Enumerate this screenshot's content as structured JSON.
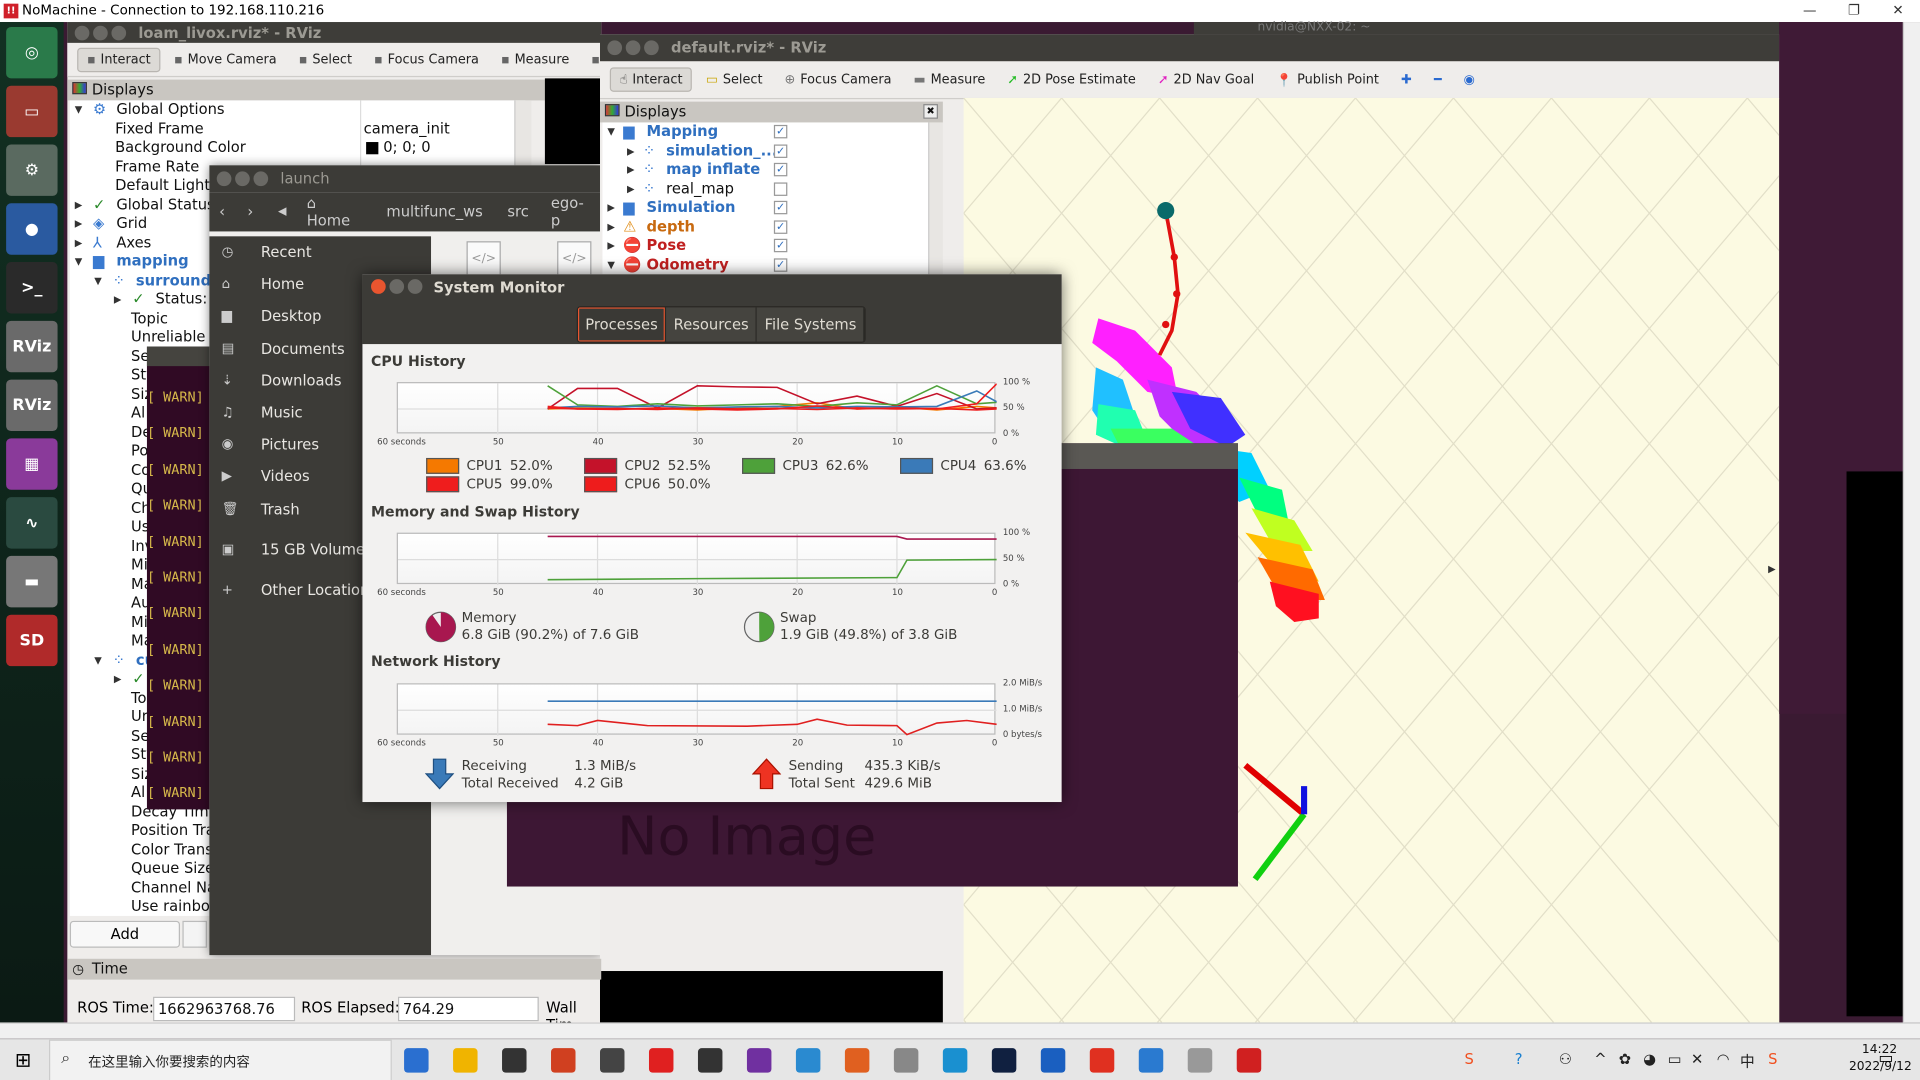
{
  "nomachine": {
    "title": "NoMachine - Connection to 192.168.110.216",
    "logo": "nm",
    "controls": [
      "—",
      "❐",
      "✕"
    ]
  },
  "dock": {
    "items": [
      {
        "name": "ubuntu-logo",
        "color": "#2a7a4a",
        "glyph": "◎"
      },
      {
        "name": "files",
        "color": "#9a3a30",
        "glyph": "▭"
      },
      {
        "name": "settings",
        "color": "#5a6a60",
        "glyph": "⚙"
      },
      {
        "name": "chromium",
        "color": "#2a5aa0",
        "glyph": "●"
      },
      {
        "name": "terminal",
        "color": "#2a2a2a",
        "glyph": ">_"
      },
      {
        "name": "rviz-1",
        "color": "#6a6a6a",
        "glyph": "RViz"
      },
      {
        "name": "rviz-2",
        "color": "#6a6a6a",
        "glyph": "RViz"
      },
      {
        "name": "workspace",
        "color": "#8a3a9a",
        "glyph": "▦"
      },
      {
        "name": "system-monitor",
        "color": "#2a4a40",
        "glyph": "∿"
      },
      {
        "name": "drive",
        "color": "#777",
        "glyph": "▬"
      },
      {
        "name": "sd-card",
        "color": "#b02a2a",
        "glyph": "SD"
      }
    ]
  },
  "left_rviz": {
    "title": "loam_livox.rviz* - RViz",
    "toolbar": [
      "Interact",
      "Move Camera",
      "Select",
      "Focus Camera",
      "Measure",
      "2"
    ],
    "displays_title": "Displays",
    "tree": [
      {
        "t": "Global Options",
        "v": "",
        "lvl": 0,
        "ar": "▼",
        "ic": "⚙",
        "cls": ""
      },
      {
        "t": "Fixed Frame",
        "v": "camera_init",
        "lvl": 1,
        "ar": "",
        "ic": "",
        "cls": ""
      },
      {
        "t": "Background Color",
        "v": "0; 0; 0",
        "lvl": 1,
        "ar": "",
        "ic": "",
        "cls": ""
      },
      {
        "t": "Frame Rate",
        "v": "",
        "lvl": 1,
        "ar": "",
        "ic": "",
        "cls": ""
      },
      {
        "t": "Default Light",
        "v": "",
        "lvl": 1,
        "ar": "",
        "ic": "",
        "cls": ""
      },
      {
        "t": "Global Status:",
        "v": "",
        "lvl": 0,
        "ar": "▶",
        "ic": "✓",
        "cls": ""
      },
      {
        "t": "Grid",
        "v": "",
        "lvl": 0,
        "ar": "▶",
        "ic": "◈",
        "cls": ""
      },
      {
        "t": "Axes",
        "v": "",
        "lvl": 0,
        "ar": "▶",
        "ic": "⅄",
        "cls": ""
      },
      {
        "t": "mapping",
        "v": "",
        "lvl": 0,
        "ar": "▼",
        "ic": "▆",
        "cls": "blue"
      },
      {
        "t": "surround",
        "v": "",
        "lvl": 1,
        "ar": "▼",
        "ic": "⁘",
        "cls": "blue"
      },
      {
        "t": "Status: O",
        "v": "",
        "lvl": 2,
        "ar": "▶",
        "ic": "✓",
        "cls": ""
      },
      {
        "t": "Topic",
        "v": "",
        "lvl": 3,
        "ar": "",
        "ic": "",
        "cls": ""
      },
      {
        "t": "Unreliable",
        "v": "",
        "lvl": 3,
        "ar": "",
        "ic": "",
        "cls": ""
      },
      {
        "t": "Se",
        "v": "",
        "lvl": 3,
        "ar": "",
        "ic": "",
        "cls": ""
      },
      {
        "t": "Sty",
        "v": "",
        "lvl": 3,
        "ar": "",
        "ic": "",
        "cls": ""
      },
      {
        "t": "Siz",
        "v": "",
        "lvl": 3,
        "ar": "",
        "ic": "",
        "cls": ""
      },
      {
        "t": "Al",
        "v": "",
        "lvl": 3,
        "ar": "",
        "ic": "",
        "cls": ""
      },
      {
        "t": "De",
        "v": "",
        "lvl": 3,
        "ar": "",
        "ic": "",
        "cls": ""
      },
      {
        "t": "Po",
        "v": "",
        "lvl": 3,
        "ar": "",
        "ic": "",
        "cls": ""
      },
      {
        "t": "Co",
        "v": "",
        "lvl": 3,
        "ar": "",
        "ic": "",
        "cls": ""
      },
      {
        "t": "Qu",
        "v": "",
        "lvl": 3,
        "ar": "",
        "ic": "",
        "cls": ""
      },
      {
        "t": "Ch",
        "v": "",
        "lvl": 3,
        "ar": "",
        "ic": "",
        "cls": ""
      },
      {
        "t": "Us",
        "v": "",
        "lvl": 3,
        "ar": "",
        "ic": "",
        "cls": ""
      },
      {
        "t": "Inv",
        "v": "",
        "lvl": 3,
        "ar": "",
        "ic": "",
        "cls": ""
      },
      {
        "t": "Mi",
        "v": "",
        "lvl": 3,
        "ar": "",
        "ic": "",
        "cls": ""
      },
      {
        "t": "Ma",
        "v": "",
        "lvl": 3,
        "ar": "",
        "ic": "",
        "cls": ""
      },
      {
        "t": "Au",
        "v": "",
        "lvl": 3,
        "ar": "",
        "ic": "",
        "cls": ""
      },
      {
        "t": "Mi",
        "v": "",
        "lvl": 3,
        "ar": "",
        "ic": "",
        "cls": ""
      },
      {
        "t": "Ma",
        "v": "",
        "lvl": 3,
        "ar": "",
        "ic": "",
        "cls": ""
      },
      {
        "t": "cu",
        "v": "",
        "lvl": 1,
        "ar": "▼",
        "ic": "⁘",
        "cls": "blue"
      },
      {
        "t": "",
        "v": "",
        "lvl": 2,
        "ar": "▶",
        "ic": "✓",
        "cls": ""
      },
      {
        "t": "To",
        "v": "",
        "lvl": 3,
        "ar": "",
        "ic": "",
        "cls": ""
      },
      {
        "t": "Ur",
        "v": "",
        "lvl": 3,
        "ar": "",
        "ic": "",
        "cls": ""
      },
      {
        "t": "Se",
        "v": "",
        "lvl": 3,
        "ar": "",
        "ic": "",
        "cls": ""
      },
      {
        "t": "Sty",
        "v": "",
        "lvl": 3,
        "ar": "",
        "ic": "",
        "cls": ""
      },
      {
        "t": "Siz",
        "v": "",
        "lvl": 3,
        "ar": "",
        "ic": "",
        "cls": ""
      },
      {
        "t": "Al",
        "v": "",
        "lvl": 3,
        "ar": "",
        "ic": "",
        "cls": ""
      },
      {
        "t": "Decay Time",
        "v": "",
        "lvl": 3,
        "ar": "",
        "ic": "",
        "cls": ""
      },
      {
        "t": "Position Tra",
        "v": "",
        "lvl": 3,
        "ar": "",
        "ic": "",
        "cls": ""
      },
      {
        "t": "Color Trans",
        "v": "",
        "lvl": 3,
        "ar": "",
        "ic": "",
        "cls": ""
      },
      {
        "t": "Queue Size",
        "v": "",
        "lvl": 3,
        "ar": "",
        "ic": "",
        "cls": ""
      },
      {
        "t": "Channel Na",
        "v": "",
        "lvl": 3,
        "ar": "",
        "ic": "",
        "cls": ""
      },
      {
        "t": "Use rainbow",
        "v": "",
        "lvl": 3,
        "ar": "",
        "ic": "",
        "cls": ""
      }
    ],
    "add_label": "Add",
    "time_title": "Time",
    "ros_time_label": "ROS Time:",
    "ros_time": "1662963768.76",
    "ros_elapsed_label": "ROS Elapsed:",
    "ros_elapsed": "764.29",
    "wall_time_label": "Wall Tim"
  },
  "terminal": {
    "warn": "[ WARN]",
    "warn_count": 12
  },
  "launch": {
    "title": "launch",
    "path": [
      "Home",
      "multifunc_ws",
      "src",
      "ego-p"
    ],
    "sidebar": [
      {
        "ic": "◷",
        "t": "Recent"
      },
      {
        "ic": "⌂",
        "t": "Home"
      },
      {
        "ic": "▆",
        "t": "Desktop"
      },
      {
        "ic": "▤",
        "t": "Documents"
      },
      {
        "ic": "⇣",
        "t": "Downloads"
      },
      {
        "ic": "♫",
        "t": "Music"
      },
      {
        "ic": "◉",
        "t": "Pictures"
      },
      {
        "ic": "▶",
        "t": "Videos"
      },
      {
        "ic": "🗑",
        "t": "Trash"
      },
      {
        "ic": "▣",
        "t": "15 GB Volume"
      },
      {
        "ic": "+",
        "t": "Other Locations"
      }
    ]
  },
  "rviz": {
    "title": "default.rviz* - RViz",
    "other_title": "nvidia@NXX-02: ~",
    "toolbar": [
      {
        "t": "Interact",
        "ic": "☝",
        "c": "#333"
      },
      {
        "t": "Select",
        "ic": "▭",
        "c": "#c9a400"
      },
      {
        "t": "Focus Camera",
        "ic": "⊕",
        "c": "#777"
      },
      {
        "t": "Measure",
        "ic": "▬",
        "c": "#777"
      },
      {
        "t": "2D Pose Estimate",
        "ic": "➚",
        "c": "#22bb22"
      },
      {
        "t": "2D Nav Goal",
        "ic": "➚",
        "c": "#e020c0"
      },
      {
        "t": "Publish Point",
        "ic": "📍",
        "c": "#d02020"
      },
      {
        "t": "",
        "ic": "✚",
        "c": "#2a6ad0"
      },
      {
        "t": "",
        "ic": "━",
        "c": "#2a6ad0"
      },
      {
        "t": "",
        "ic": "◉",
        "c": "#2a6ad0"
      }
    ],
    "displays_title": "Displays",
    "tree": [
      {
        "t": "Mapping",
        "lvl": 0,
        "ar": "▼",
        "ic": "▆",
        "cls": "blue",
        "chk": true
      },
      {
        "t": "simulation_...",
        "lvl": 1,
        "ar": "▶",
        "ic": "⁘",
        "cls": "blue",
        "chk": true
      },
      {
        "t": "map inflate",
        "lvl": 1,
        "ar": "▶",
        "ic": "⁘",
        "cls": "blue",
        "chk": true
      },
      {
        "t": "real_map",
        "lvl": 1,
        "ar": "▶",
        "ic": "⁘",
        "cls": "",
        "chk": false
      },
      {
        "t": "Simulation",
        "lvl": 0,
        "ar": "▶",
        "ic": "▆",
        "cls": "blue",
        "chk": true
      },
      {
        "t": "depth",
        "lvl": 0,
        "ar": "▶",
        "ic": "⚠",
        "cls": "orange",
        "chk": true
      },
      {
        "t": "Pose",
        "lvl": 0,
        "ar": "▶",
        "ic": "⛔",
        "cls": "red",
        "chk": true
      },
      {
        "t": "Odometry",
        "lvl": 0,
        "ar": "▼",
        "ic": "⛔",
        "cls": "red",
        "chk": true
      }
    ],
    "image_panel": "No Image"
  },
  "system_monitor": {
    "title": "System Monitor",
    "tabs": [
      "Processes",
      "Resources",
      "File Systems"
    ],
    "active_tab": "Resources",
    "cpu_title": "CPU History",
    "mem_title": "Memory and Swap History",
    "net_title": "Network History",
    "x_ticks": [
      "60 seconds",
      "50",
      "40",
      "30",
      "20",
      "10",
      "0"
    ],
    "cpu_y_ticks": [
      "100 %",
      "50 %",
      "0 %"
    ],
    "net_y_ticks": [
      "2.0 MiB/s",
      "1.0 MiB/s",
      "0 bytes/s"
    ],
    "cpus": [
      {
        "label": "CPU1",
        "value": "52.0%",
        "color": "#f57900"
      },
      {
        "label": "CPU2",
        "value": "52.5%",
        "color": "#c4122a"
      },
      {
        "label": "CPU3",
        "value": "62.6%",
        "color": "#4ea13a"
      },
      {
        "label": "CPU4",
        "value": "63.6%",
        "color": "#3a7ab8"
      },
      {
        "label": "CPU5",
        "value": "99.0%",
        "color": "#ef1d1d"
      },
      {
        "label": "CPU6",
        "value": "50.0%",
        "color": "#ee1c1c"
      }
    ],
    "memory": {
      "label": "Memory",
      "value": "6.8 GiB (90.2%) of 7.6 GiB",
      "fraction": 0.902,
      "color": "#a8174f"
    },
    "swap": {
      "label": "Swap",
      "value": "1.9 GiB (49.8%) of 3.8 GiB",
      "fraction": 0.498,
      "color": "#4ea13a"
    },
    "receiving_label": "Receiving",
    "receiving": "1.3 MiB/s",
    "total_received_label": "Total Received",
    "total_received": "4.2 GiB",
    "sending_label": "Sending",
    "sending": "435.3 KiB/s",
    "total_sent_label": "Total Sent",
    "total_sent": "429.6 MiB"
  },
  "chart_data": [
    {
      "type": "line",
      "title": "CPU History",
      "xlim": [
        60,
        0
      ],
      "ylim": [
        0,
        100
      ],
      "x": [
        45,
        42,
        38,
        34,
        30,
        26,
        22,
        18,
        14,
        10,
        6,
        2,
        0
      ],
      "series": [
        {
          "name": "CPU1",
          "values": [
            50,
            52,
            50,
            51,
            48,
            52,
            55,
            62,
            50,
            54,
            48,
            55,
            52
          ]
        },
        {
          "name": "CPU2",
          "values": [
            50,
            90,
            90,
            52,
            95,
            93,
            92,
            60,
            75,
            55,
            80,
            50,
            52
          ]
        },
        {
          "name": "CPU3",
          "values": [
            95,
            58,
            55,
            60,
            56,
            58,
            60,
            55,
            62,
            58,
            95,
            60,
            63
          ]
        },
        {
          "name": "CPU4",
          "values": [
            52,
            55,
            54,
            56,
            52,
            54,
            55,
            52,
            55,
            54,
            55,
            85,
            64
          ]
        },
        {
          "name": "CPU5",
          "values": [
            55,
            50,
            49,
            52,
            50,
            48,
            50,
            56,
            50,
            52,
            50,
            60,
            99
          ]
        },
        {
          "name": "CPU6",
          "values": [
            52,
            50,
            51,
            49,
            52,
            50,
            51,
            49,
            52,
            50,
            51,
            48,
            50
          ]
        }
      ]
    },
    {
      "type": "line",
      "title": "Memory and Swap History",
      "xlim": [
        60,
        0
      ],
      "ylim": [
        0,
        100
      ],
      "x": [
        45,
        30,
        10,
        9,
        0
      ],
      "series": [
        {
          "name": "Memory",
          "values": [
            95,
            95,
            95,
            90,
            90
          ]
        },
        {
          "name": "Swap",
          "values": [
            11,
            13,
            15,
            49,
            50
          ]
        }
      ]
    },
    {
      "type": "line",
      "title": "Network History",
      "xlim": [
        60,
        0
      ],
      "ylim": [
        0,
        2
      ],
      "y_unit": "MiB/s",
      "x": [
        45,
        42,
        40,
        35,
        25,
        20,
        18,
        15,
        10,
        9,
        6,
        3,
        0
      ],
      "series": [
        {
          "name": "Receiving",
          "values": [
            1.35,
            1.35,
            1.35,
            1.35,
            1.35,
            1.35,
            1.35,
            1.35,
            1.35,
            1.35,
            1.35,
            1.35,
            1.35
          ]
        },
        {
          "name": "Sending",
          "values": [
            0.45,
            0.4,
            0.6,
            0.4,
            0.38,
            0.45,
            0.65,
            0.42,
            0.4,
            0.05,
            0.5,
            0.6,
            0.45
          ]
        }
      ]
    }
  ],
  "taskbar": {
    "search_placeholder": "在这里输入你要搜索的内容",
    "time": "14:22",
    "date": "2022/9/12",
    "apps": [
      "#2a6fd0",
      "#f0b400",
      "#333",
      "#d04020",
      "#444",
      "#e02020",
      "#333",
      "#7030a0",
      "#2a8ad0",
      "#e06020",
      "#888",
      "#1a90d0",
      "#102040",
      "#1a5fc0",
      "#e03020",
      "#2a7ad0",
      "#999",
      "#d02020"
    ],
    "tray": [
      "sogou-icon",
      "help-icon",
      "people-icon",
      "chevron-up-icon",
      "app-icon",
      "qq-icon",
      "battery-icon",
      "mute-icon",
      "wifi-icon",
      "ime-icon",
      "sogou-icon"
    ]
  }
}
